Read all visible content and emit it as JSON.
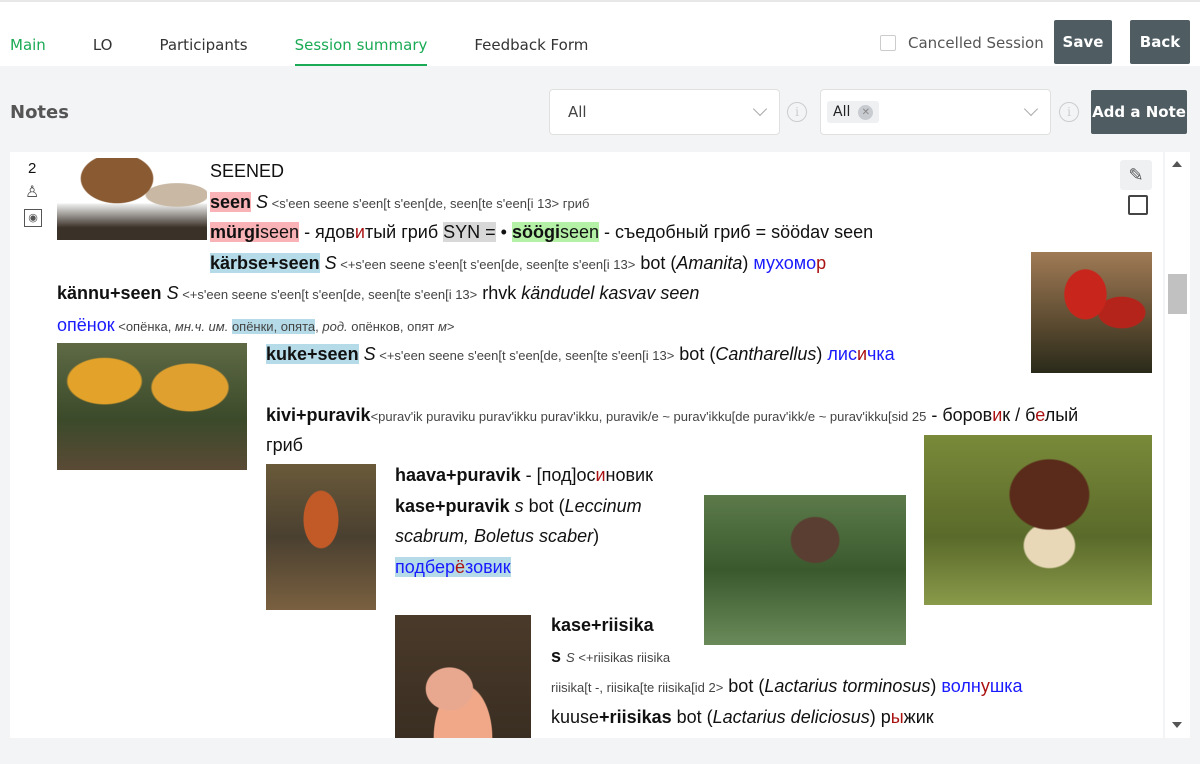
{
  "tabs": [
    {
      "label": "Main",
      "state": "green"
    },
    {
      "label": "LO"
    },
    {
      "label": "Participants"
    },
    {
      "label": "Session summary",
      "state": "active"
    },
    {
      "label": "Feedback Form"
    }
  ],
  "cancelled_session": {
    "label": "Cancelled Session",
    "checked": false
  },
  "buttons": {
    "save": "Save",
    "back": "Back",
    "add_note": "Add a Note"
  },
  "notes": {
    "title": "Notes",
    "filter1": "All",
    "filter2_chip": "All"
  },
  "note": {
    "number": "2",
    "icons": [
      "user-icon",
      "eye-icon"
    ],
    "actions": [
      "pencil-icon",
      "checkbox"
    ],
    "lines": [
      [
        {
          "t": "SEENED"
        }
      ],
      [
        {
          "t": "seen",
          "c": "b hr"
        },
        {
          "t": " "
        },
        {
          "t": "S",
          "c": "i"
        },
        {
          "t": " <s'een seene s'een[t s'een[de, seen[te s'een[i 13> гриб",
          "c": "sm"
        }
      ],
      [
        {
          "t": "mürgi",
          "c": "b hr"
        },
        {
          "t": "seen",
          "c": "hr"
        },
        {
          "t": " - ядов"
        },
        {
          "t": "и",
          "c": "rd"
        },
        {
          "t": "тый гриб "
        },
        {
          "t": "SYN =",
          "c": "hx"
        },
        {
          "t": " • "
        },
        {
          "t": "söögi",
          "c": "b hg"
        },
        {
          "t": "seen",
          "c": "hg"
        },
        {
          "t": " - съедобный гриб = söödav seen"
        }
      ],
      [
        {
          "t": "kärbse+seen",
          "c": "b hb"
        },
        {
          "t": " "
        },
        {
          "t": "S",
          "c": "i"
        },
        {
          "t": " <+s'een seene s'een[t s'een[de, seen[te s'een[i 13>",
          "c": "sm"
        },
        {
          "t": " bot ("
        },
        {
          "t": "Amanita",
          "c": "i"
        },
        {
          "t": ") "
        },
        {
          "t": "мухомо",
          "c": "bl"
        },
        {
          "t": "р",
          "c": "rd"
        }
      ],
      [
        {
          "t": "kännu+seen",
          "c": "b"
        },
        {
          "t": " "
        },
        {
          "t": "S",
          "c": "i"
        },
        {
          "t": " <+s'een seene s'een[t s'een[de, seen[te s'een[i 13>",
          "c": "sm"
        },
        {
          "t": " rhvk "
        },
        {
          "t": "kändudel kasvav seen",
          "c": "i"
        }
      ],
      [
        {
          "t": "опёнок",
          "c": "bl"
        },
        {
          "t": " <опёнка, ",
          "c": "sm"
        },
        {
          "t": "мн.ч. им.",
          "c": "sm i"
        },
        {
          "t": " ",
          "c": "sm"
        },
        {
          "t": "опёнки, опята",
          "c": "sm hb"
        },
        {
          "t": ", ",
          "c": "sm"
        },
        {
          "t": "род.",
          "c": "sm i"
        },
        {
          "t": " опёнков, опят ",
          "c": "sm"
        },
        {
          "t": "м",
          "c": "sm i"
        },
        {
          "t": ">",
          "c": "sm"
        }
      ],
      [
        {
          "t": "kuke+seen",
          "c": "b hb"
        },
        {
          "t": " "
        },
        {
          "t": "S",
          "c": "i"
        },
        {
          "t": " <+s'een seene s'een[t s'een[de, seen[te s'een[i 13>",
          "c": "sm"
        },
        {
          "t": " bot ("
        },
        {
          "t": "Cantharellus",
          "c": "i"
        },
        {
          "t": ") "
        },
        {
          "t": "лис",
          "c": "bl"
        },
        {
          "t": "и",
          "c": "rd"
        },
        {
          "t": "чка",
          "c": "bl"
        }
      ],
      [
        {
          "t": "kivi+puravik",
          "c": "b"
        },
        {
          "t": "<purav'ik puraviku purav'ikku purav'ikku, puravik/e ~ purav'ikku[de purav'ikk/e ~ purav'ikku[sid 25",
          "c": "sm"
        },
        {
          "t": " - боров"
        },
        {
          "t": "и",
          "c": "rd"
        },
        {
          "t": "к / б"
        },
        {
          "t": "е",
          "c": "rd"
        },
        {
          "t": "лый"
        }
      ],
      [
        {
          "t": "гриб"
        }
      ],
      [
        {
          "t": "haava+puravik",
          "c": "b"
        },
        {
          "t": " - [под]ос"
        },
        {
          "t": "и",
          "c": "rd"
        },
        {
          "t": "новик"
        }
      ],
      [
        {
          "t": "kase+puravik",
          "c": "b"
        },
        {
          "t": " "
        },
        {
          "t": "s",
          "c": "i"
        },
        {
          "t": "  bot ("
        },
        {
          "t": "Leccinum",
          "c": "i"
        }
      ],
      [
        {
          "t": "scabrum, Boletus scaber",
          "c": "i"
        },
        {
          "t": ")"
        }
      ],
      [
        {
          "t": "подбер",
          "c": "bl hb"
        },
        {
          "t": "ё",
          "c": "rd hb"
        },
        {
          "t": "зовик",
          "c": "bl hb"
        }
      ],
      [
        {
          "t": "kase+riisika",
          "c": "b"
        }
      ],
      [
        {
          "t": "s",
          "c": "b"
        },
        {
          "t": " "
        },
        {
          "t": "S",
          "c": "i sm"
        },
        {
          "t": " <+riisikas riisika",
          "c": "sm"
        }
      ],
      [
        {
          "t": "riisika[t -, riisika[te riisika[id 2>",
          "c": "sm"
        },
        {
          "t": " bot ("
        },
        {
          "t": "Lactarius torminosus",
          "c": "i"
        },
        {
          "t": ") "
        },
        {
          "t": "волн",
          "c": "bl"
        },
        {
          "t": "у",
          "c": "rd"
        },
        {
          "t": "шка",
          "c": "bl"
        }
      ],
      [
        {
          "t": "kuuse"
        },
        {
          "t": "+riisikas",
          "c": "b"
        },
        {
          "t": " bot ("
        },
        {
          "t": "Lactarius deliciosus",
          "c": "i"
        },
        {
          "t": ") р"
        },
        {
          "t": "ы",
          "c": "rd"
        },
        {
          "t": "жик"
        }
      ]
    ]
  }
}
